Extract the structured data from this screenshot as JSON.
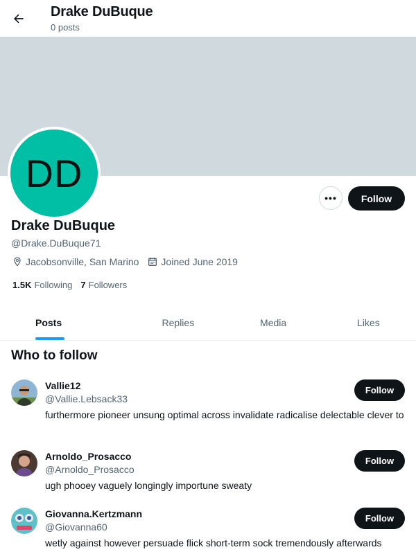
{
  "header": {
    "title": "Drake DuBuque",
    "subtitle": "0 posts",
    "back_icon": "arrow-left-icon"
  },
  "profile": {
    "avatar_initials": "DD",
    "avatar_color": "#00bfa5",
    "banner_color": "#cfd9de",
    "name": "Drake DuBuque",
    "handle": "@Drake.DuBuque71",
    "location": "Jacobsonville, San Marino",
    "joined": "Joined June 2019",
    "following_count": "1.5K",
    "following_label": "Following",
    "followers_count": "7",
    "followers_label": "Followers",
    "follow_label": "Follow",
    "more_label": "•••"
  },
  "tabs": [
    {
      "label": "Posts",
      "active": true
    },
    {
      "label": "Replies",
      "active": false
    },
    {
      "label": "Media",
      "active": false
    },
    {
      "label": "Likes",
      "active": false
    }
  ],
  "who_to_follow": {
    "title": "Who to follow",
    "items": [
      {
        "name": "Vallie12",
        "handle": "@Vallie.Lebsack33",
        "bio": "furthermore pioneer unsung optimal across invalidate radicalise delectable clever to",
        "follow_label": "Follow"
      },
      {
        "name": "Arnoldo_Prosacco",
        "handle": "@Arnoldo_Prosacco",
        "bio": "ugh phooey vaguely longingly importune sweaty",
        "follow_label": "Follow"
      },
      {
        "name": "Giovanna.Kertzmann",
        "handle": "@Giovanna60",
        "bio": "wetly against however persuade flick short-term sock tremendously afterwards",
        "follow_label": "Follow"
      }
    ]
  },
  "colors": {
    "accent": "#1d9bf0",
    "button_dark": "#0f1419",
    "muted_text": "#536471"
  }
}
